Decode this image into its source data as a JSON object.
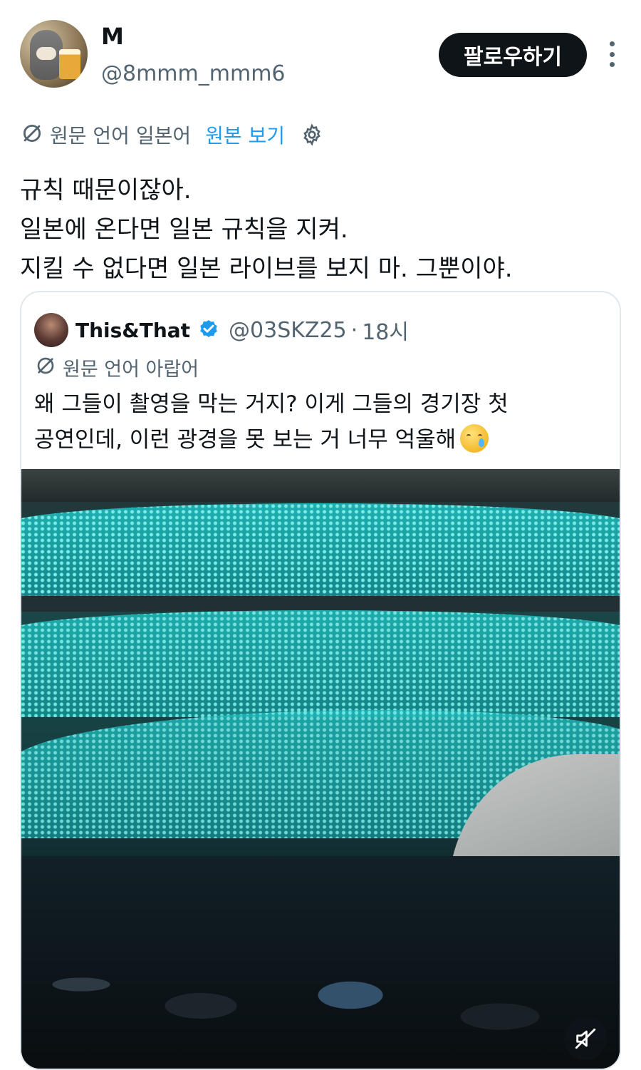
{
  "author": {
    "display_name": "M",
    "handle": "@8mmm_mmm6",
    "avatar_icon": "avatar-icon"
  },
  "follow_label": "팔로우하기",
  "more_icon": "more-options-icon",
  "translation": {
    "original_language": "원문 언어 일본어",
    "show_original": "원본 보기",
    "settings_icon": "gear-icon"
  },
  "tweet": {
    "lines": [
      "규칙 때문이잖아.",
      "일본에 온다면 일본 규칙을 지켜.",
      "지킬 수 없다면 일본 라이브를 보지 마. 그뿐이야."
    ]
  },
  "quote": {
    "name": "This&That",
    "handle": "@03SKZ25",
    "separator": "·",
    "time": "18시",
    "original_language": "원문 언어 아랍어",
    "lines": [
      "왜 그들이 촬영을 막는 거지? 이게 그들의 경기장 첫",
      "공연인데, 이런 광경을 못 보는 거 너무 억울해"
    ],
    "emoji": "crying-face",
    "media_icon": "mute-icon"
  },
  "colors": {
    "text": "#0f1419",
    "secondary": "#536471",
    "link": "#1d9bf0",
    "button": "#0f1419",
    "border": "#e1e8ed"
  }
}
